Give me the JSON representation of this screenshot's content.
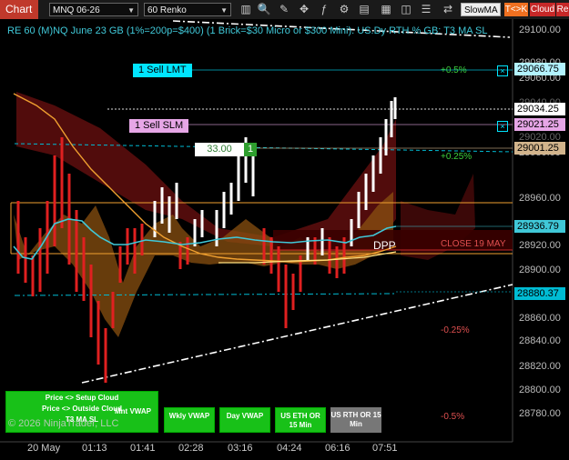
{
  "toolbar": {
    "chart_tab": "Chart",
    "instrument": "MNQ 06-26",
    "bar_type": "60 Renko",
    "slow_ma": "SlowMA",
    "tck_button": "T<>K",
    "cloud_button": "Cloud",
    "re_button": "Re"
  },
  "header": {
    "title": "RE 60 (M)NQ June 23 GB (1%=200p=$400) (1 Brick=$30 Micro or $300 Mini). US.Dy RTH % GB: T3 MA SL"
  },
  "orders": {
    "sell_lmt": {
      "label": "1 Sell LMT",
      "price": "29066.75"
    },
    "sell_slm": {
      "label": "1 Sell SLM",
      "price": "29021.25"
    },
    "position": {
      "value": "33.00",
      "qty": "1",
      "price": "29001.25"
    }
  },
  "price_axis": {
    "ticks": [
      "29100.00",
      "29080.00",
      "29060.00",
      "29040.00",
      "29020.00",
      "28980.00",
      "28960.00",
      "28920.00",
      "28900.00",
      "28880.00",
      "28860.00",
      "28840.00",
      "28820.00",
      "28800.00",
      "28780.00"
    ],
    "last_price": "29034.25",
    "ma_price": "28936.79",
    "low_price": "28880.37"
  },
  "time_axis": [
    "20 May",
    "01:13",
    "01:41",
    "02:28",
    "03:16",
    "04:24",
    "06:16",
    "07:51"
  ],
  "annotations": {
    "pct_up_05": "+0.5%",
    "pct_up_025": "+0.25%",
    "pct_dn_025": "-0.25%",
    "pct_dn_05": "-0.5%",
    "close_label": "CLOSE 19 MAY",
    "dpp": "DPP",
    "copyright": "© 2026 NinjaTrader, LLC"
  },
  "buttons": {
    "setup_cloud": "Price <> Setup Cloud",
    "outside_cloud": "Price <> Outside Cloud",
    "t3_ma_sl": "T3 MA SL",
    "mnt_vwap": "Mnt VWAP",
    "wkly_vwap": "Wkly VWAP",
    "day_vwap": "Day VWAP",
    "us_eth_or": "US ETH OR 15 Min",
    "us_rth_or": "US RTH OR 15 Min"
  },
  "colors": {
    "accent_red": "#c0392b",
    "cyan": "#00e5ff",
    "pink": "#e6a6e6",
    "orange": "#f0a030",
    "green_button": "#18c118"
  }
}
